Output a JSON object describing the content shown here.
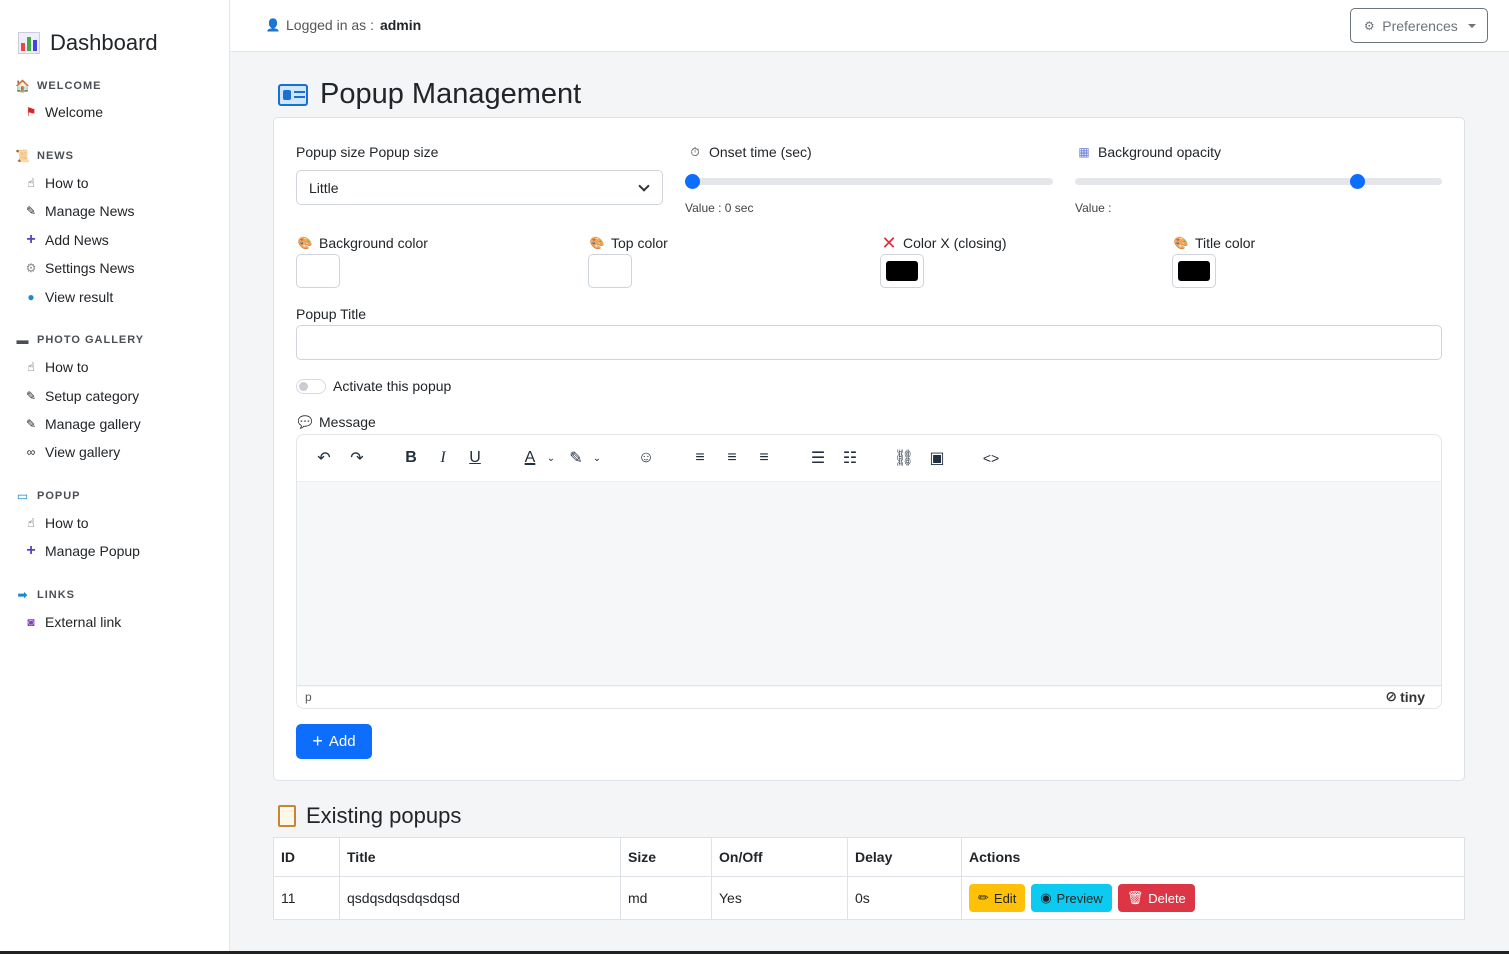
{
  "sidebar": {
    "brand": "Dashboard",
    "sections": [
      {
        "title": "WELCOME",
        "items": [
          {
            "label": "Welcome",
            "icon": "flag-icon"
          }
        ]
      },
      {
        "title": "NEWS",
        "items": [
          {
            "label": "How to",
            "icon": "hand-icon"
          },
          {
            "label": "Manage News",
            "icon": "pen-icon"
          },
          {
            "label": "Add News",
            "icon": "plus-icon"
          },
          {
            "label": "Settings News",
            "icon": "gear-icon"
          },
          {
            "label": "View result",
            "icon": "globe-icon"
          }
        ]
      },
      {
        "title": "PHOTO GALLERY",
        "items": [
          {
            "label": "How to",
            "icon": "hand-icon"
          },
          {
            "label": "Setup category",
            "icon": "pen-icon"
          },
          {
            "label": "Manage gallery",
            "icon": "pen-icon"
          },
          {
            "label": "View gallery",
            "icon": "binoculars-icon"
          }
        ]
      },
      {
        "title": "POPUP",
        "items": [
          {
            "label": "How to",
            "icon": "hand-icon"
          },
          {
            "label": "Manage Popup",
            "icon": "plus-icon"
          }
        ]
      },
      {
        "title": "LINKS",
        "items": [
          {
            "label": "External link",
            "icon": "link-icon"
          }
        ]
      }
    ]
  },
  "header": {
    "logged_prefix": "Logged in as : ",
    "user": "admin",
    "preferences": "Preferences"
  },
  "main": {
    "title": "Popup Management",
    "form": {
      "size_label": "Popup size Popup size",
      "size_value": "Little",
      "onset_label": "Onset time (sec)",
      "onset_value_text": "Value : 0 sec",
      "onset_value": 0,
      "opacity_label": "Background opacity",
      "opacity_value_text": "Value :",
      "opacity_fraction": 0.78,
      "bg_color_label": "Background color",
      "top_color_label": "Top color",
      "colorx_label": "Color X (closing)",
      "title_color_label": "Title color",
      "bg_color": "#ffffff",
      "top_color": "#ffffff",
      "colorx": "#000000",
      "title_color": "#000000",
      "popup_title_label": "Popup Title",
      "popup_title_value": "",
      "activate_label": "Activate this popup",
      "message_label": "Message",
      "editor_status": "p",
      "editor_brand": "tiny",
      "add_button": "Add"
    },
    "existing_title": "Existing popups",
    "table": {
      "headers": [
        "ID",
        "Title",
        "Size",
        "On/Off",
        "Delay",
        "Actions"
      ],
      "rows": [
        {
          "id": "11",
          "title": "qsdqsdqsdqsdqsd",
          "size": "md",
          "onoff": "Yes",
          "delay": "0s"
        }
      ],
      "actions": {
        "edit": "Edit",
        "preview": "Preview",
        "delete": "Delete"
      }
    }
  },
  "colors": {
    "primary": "#0d6efd",
    "warning": "#ffc107",
    "info": "#0dcaf0",
    "danger": "#dc3545"
  }
}
